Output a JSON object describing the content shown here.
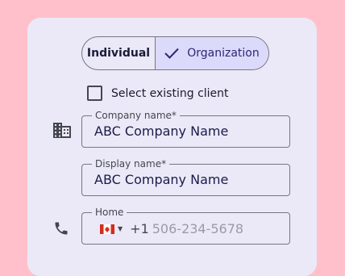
{
  "client_type": {
    "individual_label": "Individual",
    "organization_label": "Organization"
  },
  "existing_client": {
    "label": "Select existing client"
  },
  "company_name": {
    "label": "Company name*",
    "value": "ABC Company Name"
  },
  "display_name": {
    "label": "Display name*",
    "value": "ABC Company Name"
  },
  "phone": {
    "label": "Home",
    "country_code": "+1",
    "placeholder": "506-234-5678",
    "country_flag": "canada-flag-icon"
  },
  "colors": {
    "background": "#ffc0cb",
    "card": "#ebe9f7",
    "selected_segment": "#dcdafa",
    "accent_text": "#2a2875"
  }
}
